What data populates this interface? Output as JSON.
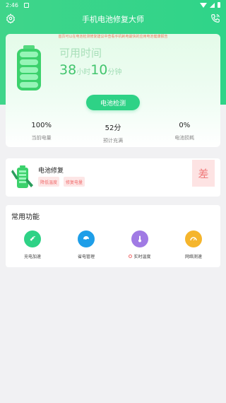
{
  "status_bar": {
    "time": "2:46"
  },
  "header": {
    "title": "手机电池修复大师"
  },
  "battery_card": {
    "notice": "首页可以在电池检测修复建议中查看手机耗电最快的应用电池健康报告",
    "available_label": "可用时间",
    "hours": "38",
    "hours_unit": "小时",
    "minutes": "10",
    "minutes_unit": "分钟",
    "detect_button": "电池检测",
    "stats": [
      {
        "value": "100%",
        "label": "当前电量"
      },
      {
        "value": "52分",
        "label": "预计充满"
      },
      {
        "value": "0%",
        "label": "电池损耗"
      }
    ]
  },
  "repair": {
    "title": "电池修复",
    "tags": [
      "降低温度",
      "修复电量"
    ],
    "grade": "差"
  },
  "common": {
    "title": "常用功能",
    "items": [
      {
        "label": "充电加速",
        "color": "#2ed286",
        "icon": "rocket-icon"
      },
      {
        "label": "省电管理",
        "color": "#1e9ee8",
        "icon": "power-save-icon"
      },
      {
        "label": "实时温度",
        "color": "#a07ae4",
        "icon": "thermometer-icon"
      },
      {
        "label": "网络测速",
        "color": "#f5b52c",
        "icon": "speedometer-icon"
      }
    ]
  }
}
